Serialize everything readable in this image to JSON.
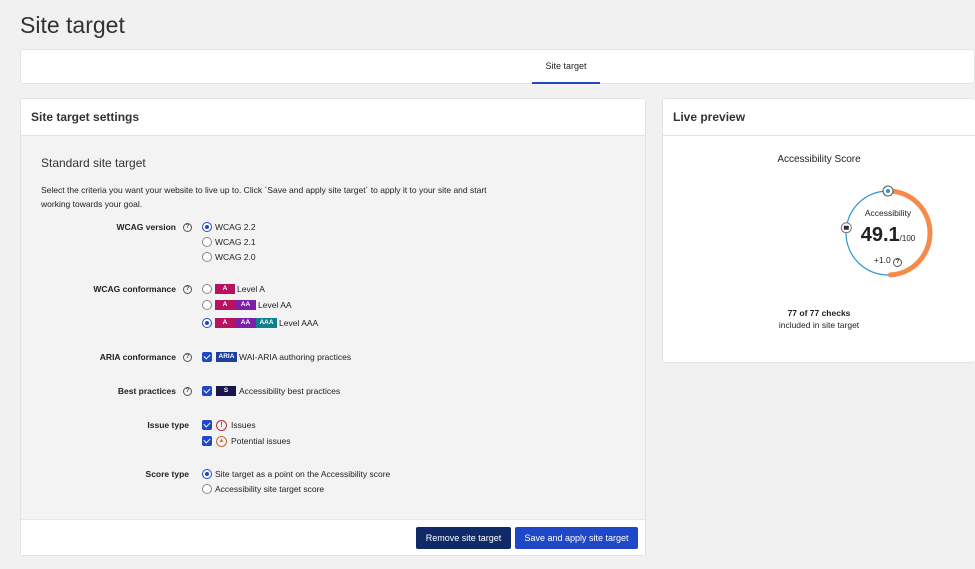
{
  "page": {
    "title": "Site target"
  },
  "tabs": [
    {
      "label": "Site target",
      "active": true
    }
  ],
  "settings": {
    "panel_title": "Site target settings",
    "section_title": "Standard site target",
    "description": "Select the criteria you want your website to live up to. Click ´Save and apply site target´ to apply it to your site and start working towards your goal.",
    "wcag_version": {
      "label": "WCAG version",
      "options": [
        "WCAG 2.2",
        "WCAG 2.1",
        "WCAG 2.0"
      ],
      "selected": "WCAG 2.2"
    },
    "wcag_conformance": {
      "label": "WCAG conformance",
      "badge_a": "A",
      "badge_aa": "AA",
      "badge_aaa": "AAA",
      "options": [
        "Level A",
        "Level AA",
        "Level AAA"
      ],
      "selected": "Level AAA"
    },
    "aria_conformance": {
      "label": "ARIA conformance",
      "badge": "ARIA",
      "option": "WAI-ARIA authoring practices",
      "checked": true
    },
    "best_practices": {
      "label": "Best practices",
      "badge": "S",
      "option": "Accessibility best practices",
      "checked": true
    },
    "issue_type": {
      "label": "Issue type",
      "options": [
        "Issues",
        "Potential issues"
      ],
      "checked": [
        true,
        true
      ]
    },
    "score_type": {
      "label": "Score type",
      "options": [
        "Site target as a point on the Accessibility score",
        "Accessibility site target score"
      ],
      "selected": "Site target as a point on the Accessibility score"
    },
    "buttons": {
      "remove": "Remove site target",
      "save": "Save and apply site target"
    }
  },
  "preview": {
    "panel_title": "Live preview",
    "score_title": "Accessibility Score",
    "gauge_label": "Accessibility",
    "score": "49.1",
    "score_max": "/100",
    "delta": "+1.0",
    "score_value": 49.1,
    "checks_line": "77 of 77 checks",
    "checks_sub": "included in site target",
    "colors": {
      "arc": "#f58a4b",
      "track": "#2a94cf",
      "accent": "#1e48c7"
    }
  }
}
